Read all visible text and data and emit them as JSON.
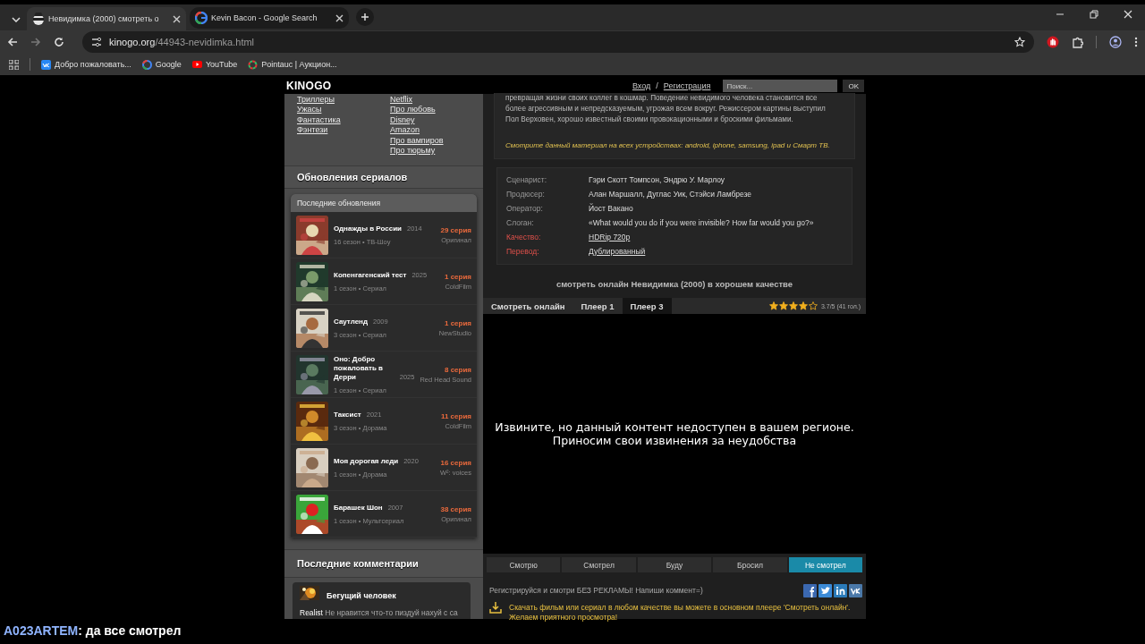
{
  "browser": {
    "tabs": [
      {
        "title": "Невидимка (2000) смотреть о",
        "selected": true
      },
      {
        "title": "Kevin Bacon - Google Search",
        "selected": false
      }
    ],
    "url": {
      "host": "kinogo.org",
      "path": "/44943-nevidimka.html"
    },
    "bookmarks": [
      {
        "label": "Добро пожаловать..."
      },
      {
        "label": "Google"
      },
      {
        "label": "YouTube"
      },
      {
        "label": "Pointauc | Аукцион..."
      }
    ]
  },
  "site": {
    "logo": "KINOGO",
    "login": "Вход",
    "separator": "/",
    "register": "Регистрация",
    "search": {
      "placeholder": "Поиск..."
    },
    "search_button": "OK"
  },
  "sidebar": {
    "genres_left": [
      "Триллеры",
      "Ужасы",
      "Фантастика",
      "Фэнтези"
    ],
    "genres_right": [
      "Netflix",
      "Про любовь",
      "Disney",
      "Amazon",
      "Про вампиров",
      "Про тюрьму"
    ],
    "updates_title": "Обновления сериалов",
    "updates_header": "Последние обновления",
    "updates": [
      {
        "title": "Однажды в России",
        "year": "2014",
        "meta": "16 сезон • ТВ-Шоу",
        "episode": "29 серия",
        "source": "Оригинал"
      },
      {
        "title": "Копенгагенский тест",
        "year": "2025",
        "meta": "1 сезон • Сериал",
        "episode": "1 серия",
        "source": "ColdFilm"
      },
      {
        "title": "Саутленд",
        "year": "2009",
        "meta": "3 сезон • Сериал",
        "episode": "1 серия",
        "source": "NewStudio"
      },
      {
        "title": "Оно: Добро пожаловать в Дерри",
        "year": "2025",
        "meta": "1 сезон • Сериал",
        "episode": "8 серия",
        "source": "Red Head Sound"
      },
      {
        "title": "Таксист",
        "year": "2021",
        "meta": "3 сезон • Дорама",
        "episode": "11 серия",
        "source": "ColdFilm"
      },
      {
        "title": "Моя дорогая леди",
        "year": "2020",
        "meta": "1 сезон • Дорама",
        "episode": "16 серия",
        "source": "W²: voices"
      },
      {
        "title": "Барашек Шон",
        "year": "2007",
        "meta": "1 сезон • Мультсериал",
        "episode": "38 серия",
        "source": "Оригинал"
      }
    ],
    "comments_title": "Последние комментарии",
    "comments": [
      {
        "title": "Бегущий человек",
        "text": "**Realist** Не нравится что-то пиздуй нахуй с са"
      }
    ]
  },
  "main": {
    "description": [
      "превращая жизни своих коллег в кошмар. Поведение невидимого человека становится все",
      "более агрессивным и непредсказуемым, угрожая всем вокруг. Режиссером картины выступил",
      "Пол Верховен, хорошо известный своими провокационными и броскими фильмами."
    ],
    "devices_note": "Смотрите данный материал на всех устройствах: android, iphone, samsung, ipad и Смарт ТВ.",
    "info": [
      {
        "label": "Сценарист:",
        "value": "Гэри Скотт Томпсон, Эндрю У. Марлоу",
        "kind": "text"
      },
      {
        "label": "Продюсер:",
        "value": "Алан Маршалл, Дуглас Уик, Стэйси Ламбрезе",
        "kind": "text"
      },
      {
        "label": "Оператор:",
        "value": "Йост Вакано",
        "kind": "text"
      },
      {
        "label": "Слоган:",
        "value": "«What would you do if you were invisible? How far would you go?»",
        "kind": "text"
      },
      {
        "label": "Качество:",
        "value": "HDRip 720p",
        "kind": "link"
      },
      {
        "label": "Перевод:",
        "value": "Дублированный",
        "kind": "link"
      }
    ],
    "watch_title": "смотреть онлайн Невидимка (2000) в хорошем качестве",
    "player_tabs": [
      {
        "label": "Смотреть онлайн",
        "selected": false
      },
      {
        "label": "Плеер 1",
        "selected": false
      },
      {
        "label": "Плеер 3",
        "selected": true
      }
    ],
    "rating": {
      "stars": 4,
      "text": "3.7/5 (41 гол.)"
    },
    "player_message": [
      "Извините, но данный контент недоступен в вашем регионе.",
      "Приносим свои извинения за неудобства"
    ],
    "statuses": [
      {
        "label": "Смотрю",
        "selected": false
      },
      {
        "label": "Смотрел",
        "selected": false
      },
      {
        "label": "Буду",
        "selected": false
      },
      {
        "label": "Бросил",
        "selected": false
      },
      {
        "label": "Не смотрел",
        "selected": true
      }
    ],
    "comment_prompt": "Регистрируйся и смотри БЕЗ РЕКЛАМЫ! Напиши коммент=)",
    "download_note": [
      "Скачать фильм или сериал в любом качестве вы можете в основном плеере 'Смотреть онлайн'.",
      "Желаем приятного просмотра!"
    ]
  },
  "chat_overlay": {
    "user": "A023ARTEM",
    "message": ": да все смотрел"
  }
}
